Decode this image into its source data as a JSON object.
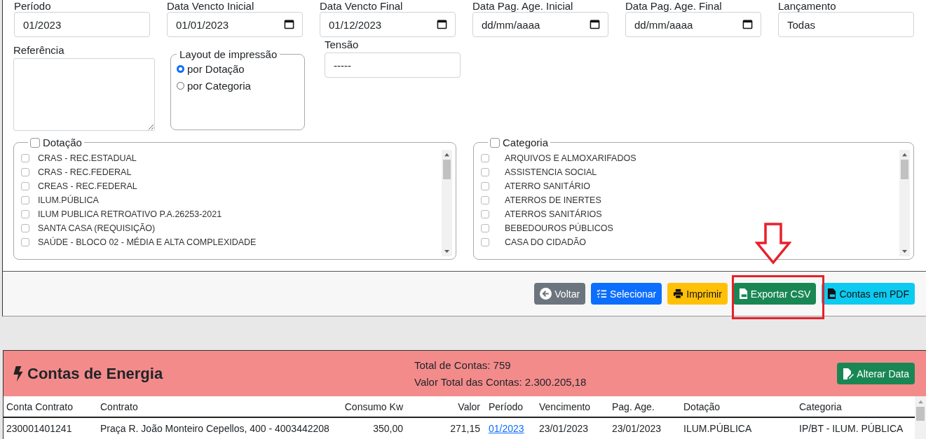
{
  "filters": [
    {
      "label": "Período",
      "kind": "text",
      "value": "01/2023"
    },
    {
      "label": "Data Vencto Inicial",
      "kind": "date",
      "value": "01/01/2023"
    },
    {
      "label": "Data Vencto Final",
      "kind": "date",
      "value": "01/12/2023"
    },
    {
      "label": "Data Pag. Age. Inicial",
      "kind": "date",
      "placeholder": "dd/mm/aaaa"
    },
    {
      "label": "Data Pag. Age. Final",
      "kind": "date",
      "placeholder": "dd/mm/aaaa"
    },
    {
      "label": "Lançamento",
      "kind": "text",
      "value": "Todas"
    }
  ],
  "reference": {
    "label": "Referência"
  },
  "print_layout": {
    "legend": "Layout de impressão",
    "options": [
      {
        "label": "por Dotação",
        "selected": true
      },
      {
        "label": "por Categoria",
        "selected": false
      }
    ]
  },
  "tension": {
    "label": "Tensão",
    "value": "-----"
  },
  "groups": [
    {
      "legend": "Dotação",
      "checked": false,
      "items": [
        {
          "label": "CRAS - REC.ESTADUAL",
          "checked": false
        },
        {
          "label": "CRAS - REC.FEDERAL",
          "checked": false
        },
        {
          "label": "CREAS - REC.FEDERAL",
          "checked": false
        },
        {
          "label": "ILUM.PÚBLICA",
          "checked": false
        },
        {
          "label": "ILUM PUBLICA RETROATIVO P.A.26253-2021",
          "checked": false
        },
        {
          "label": "SANTA CASA (REQUISIÇÃO)",
          "checked": false
        },
        {
          "label": "SAÚDE - BLOCO 02 - MÉDIA E ALTA COMPLEXIDADE",
          "checked": false
        }
      ]
    },
    {
      "legend": "Categoria",
      "checked": false,
      "items": [
        {
          "label": "ARQUIVOS E ALMOXARIFADOS",
          "checked": false
        },
        {
          "label": "ASSISTENCIA SOCIAL",
          "checked": false
        },
        {
          "label": "ATERRO SANITÁRIO",
          "checked": false
        },
        {
          "label": "ATERROS DE INERTES",
          "checked": false
        },
        {
          "label": "ATERROS SANITÁRIOS",
          "checked": false
        },
        {
          "label": "BEBEDOUROS PÚBLICOS",
          "checked": false
        },
        {
          "label": "CASA DO CIDADÃO",
          "checked": false
        }
      ]
    }
  ],
  "actions": [
    {
      "label": "Voltar",
      "kind": "back"
    },
    {
      "label": "Selecionar",
      "kind": "select"
    },
    {
      "label": "Imprimir",
      "kind": "print"
    },
    {
      "label": "Exportar CSV",
      "kind": "csv"
    },
    {
      "label": "Contas em PDF",
      "kind": "pdf"
    }
  ],
  "energy": {
    "title": "Contas de Energia",
    "total_count": "Total de Contas: 759",
    "total_value": "Valor Total das Contas: 2.300.205,18",
    "button": "Alterar Data",
    "columns": [
      {
        "label": "Conta Contrato",
        "kind": "text"
      },
      {
        "label": "Contrato",
        "kind": "text"
      },
      {
        "label": "Consumo Kw",
        "kind": "number"
      },
      {
        "label": "Valor",
        "kind": "number"
      },
      {
        "label": "Período",
        "kind": "link"
      },
      {
        "label": "Vencimento",
        "kind": "text"
      },
      {
        "label": "Pag. Age.",
        "kind": "text"
      },
      {
        "label": "Dotação",
        "kind": "text"
      },
      {
        "label": "Categoria",
        "kind": "text"
      }
    ],
    "rows": [
      [
        "230001401241",
        "Praça R. João Monteiro Cepellos, 400 - 4003442208",
        "350,00",
        "271,15",
        "01/2023",
        "23/01/2023",
        "23/01/2023",
        "ILUM.PÚBLICA",
        "IP/BT - ILUM. PÚBLICA"
      ]
    ]
  }
}
